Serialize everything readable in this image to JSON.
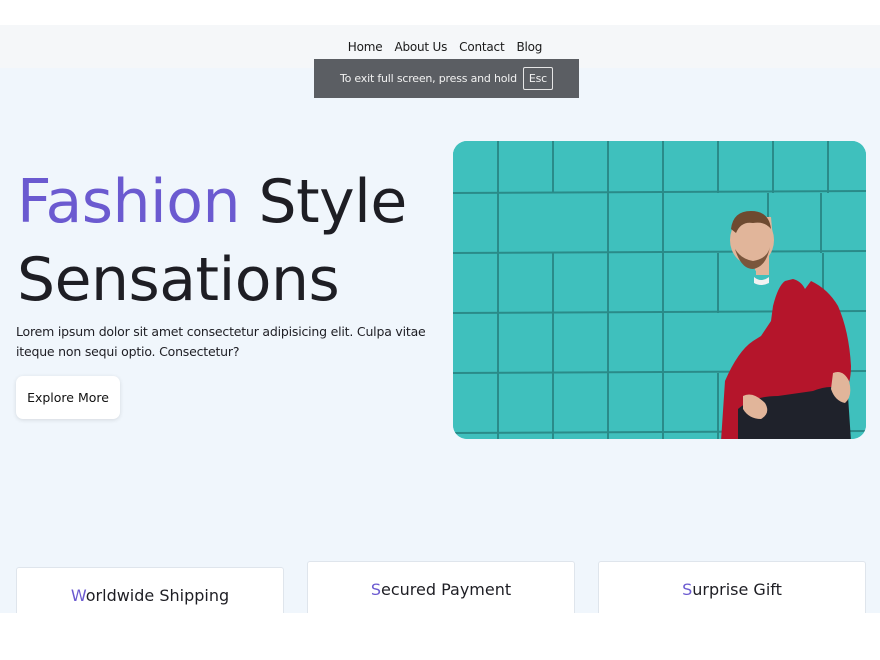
{
  "nav": {
    "links": [
      "Home",
      "About Us",
      "Contact",
      "Blog"
    ]
  },
  "fullscreen_toast": {
    "message": "To exit full screen, press and hold",
    "key": "Esc"
  },
  "hero": {
    "title_accent": "Fashion",
    "title_rest_line1": "Style",
    "title_line2": "Sensations",
    "description": "Lorem ipsum dolor sit amet consectetur adipisicing elit. Culpa vitae iteque non sequi optio. Consectetur?",
    "button_label": "Explore More",
    "image_icon": "man-in-red-sweater-photo"
  },
  "features": [
    {
      "first_letter": "W",
      "rest": "orldwide Shipping"
    },
    {
      "first_letter": "S",
      "rest": "ecured Payment"
    },
    {
      "first_letter": "S",
      "rest": "urprise Gift"
    }
  ],
  "colors": {
    "accent": "#6b5ad0",
    "page_background": "#f0f6fc",
    "wall": "#3fc0bd",
    "sweater": "#b5152b"
  }
}
